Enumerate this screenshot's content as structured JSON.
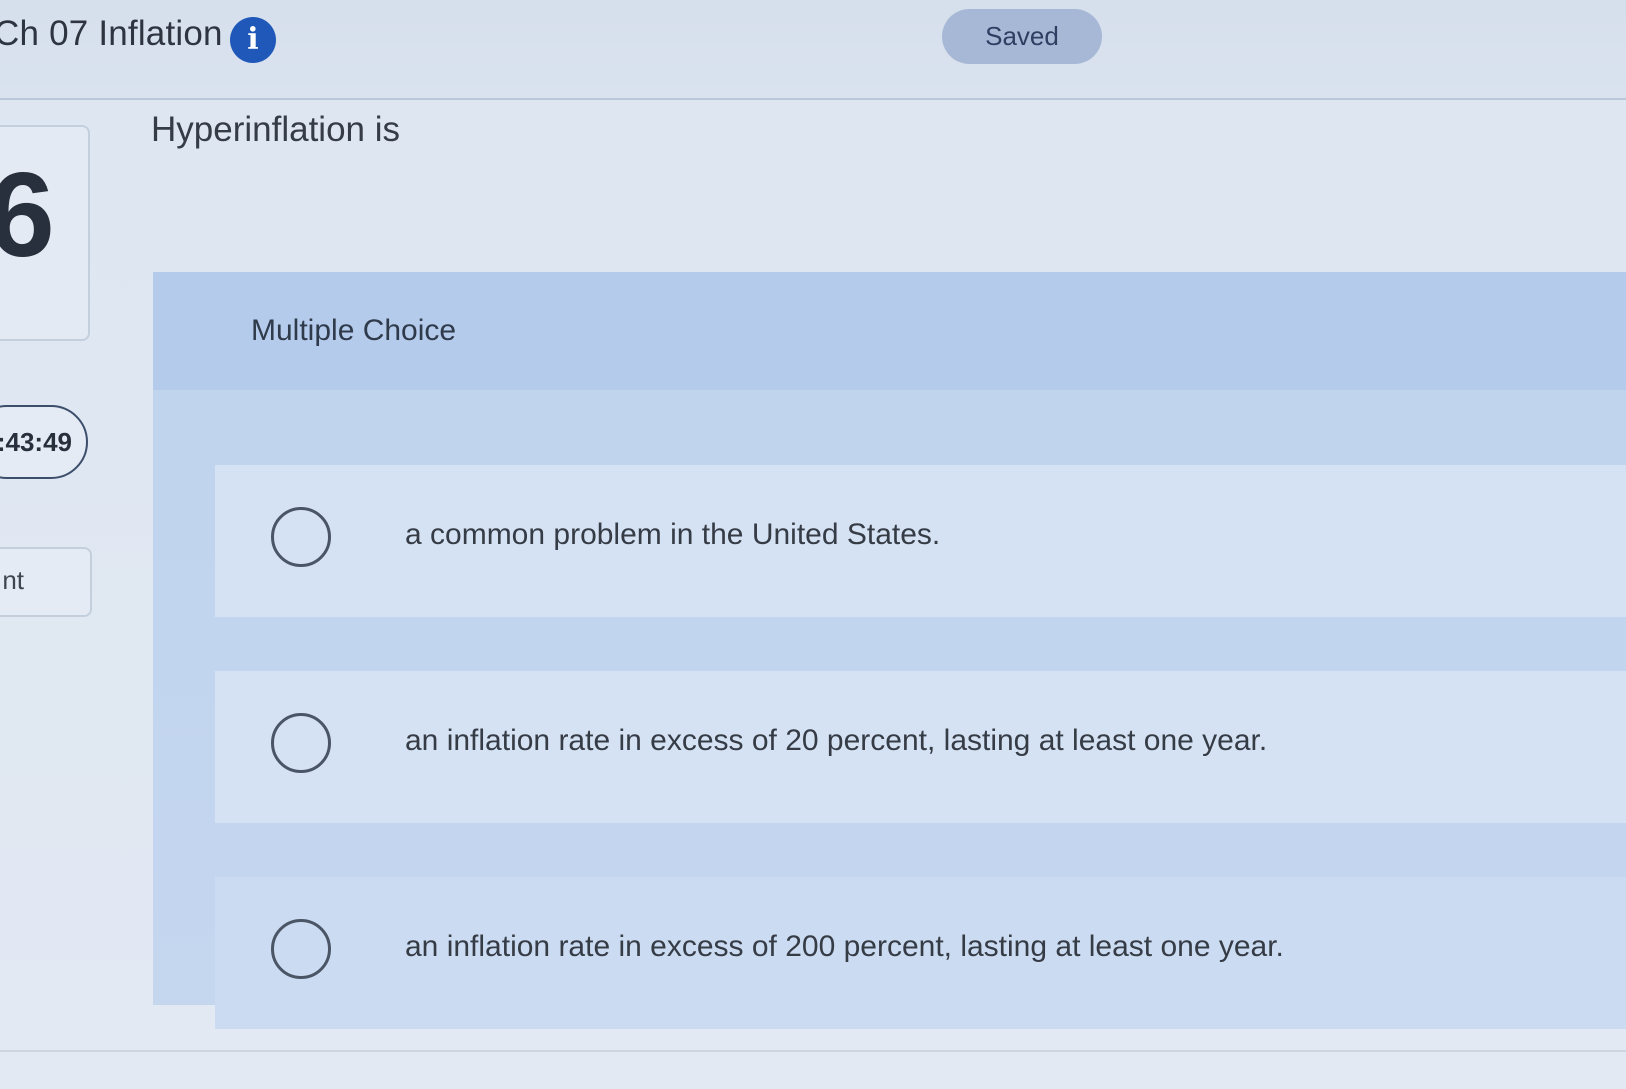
{
  "header": {
    "title": "Ch 07 Inflation",
    "info_icon": "info-icon",
    "saved_label": "Saved"
  },
  "sidebar": {
    "question_number": "6",
    "timer": ":43:49",
    "button_label": "nt"
  },
  "question": {
    "prompt": "Hyperinflation is",
    "type_label": "Multiple Choice",
    "choices": [
      {
        "label": "a common problem in the United States."
      },
      {
        "label": "an inflation rate in excess of 20 percent, lasting at least one year."
      },
      {
        "label": "an inflation rate in excess of 200 percent, lasting at least one year."
      }
    ]
  },
  "colors": {
    "accent": "#1f58b8",
    "saved_pill": "#a7b8d6",
    "panel": "#c5d7ef"
  }
}
